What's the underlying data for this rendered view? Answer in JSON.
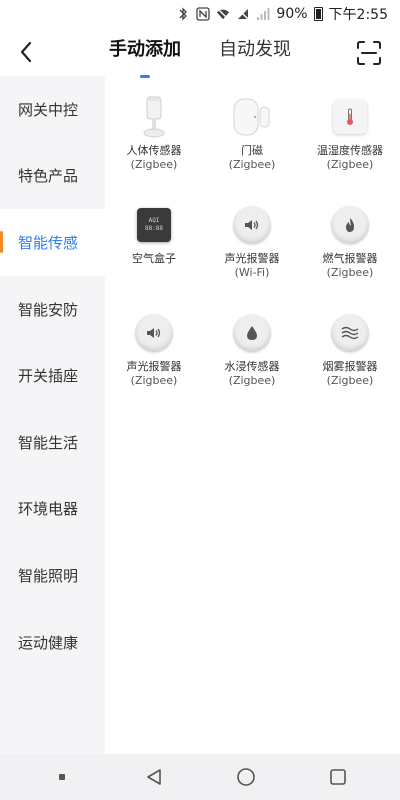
{
  "status": {
    "battery": "90%",
    "time": "下午2:55",
    "icons": [
      "bluetooth-icon",
      "nfc-icon",
      "wifi-icon",
      "mute-icon",
      "signal-icon",
      "battery-icon"
    ]
  },
  "header": {
    "tabs": [
      {
        "label": "手动添加",
        "active": true
      },
      {
        "label": "自动发现",
        "active": false
      }
    ]
  },
  "sidebar": {
    "items": [
      {
        "label": "网关中控"
      },
      {
        "label": "特色产品"
      },
      {
        "label": "智能传感",
        "active": true
      },
      {
        "label": "智能安防"
      },
      {
        "label": "开关插座"
      },
      {
        "label": "智能生活"
      },
      {
        "label": "环境电器"
      },
      {
        "label": "智能照明"
      },
      {
        "label": "运动健康"
      }
    ]
  },
  "devices": [
    {
      "name": "人体传感器",
      "protocol": "(Zigbee)",
      "icon": "motion-sensor-icon"
    },
    {
      "name": "门磁",
      "protocol": "(Zigbee)",
      "icon": "door-sensor-icon"
    },
    {
      "name": "温湿度传感器",
      "protocol": "(Zigbee)",
      "icon": "thermometer-icon"
    },
    {
      "name": "空气盒子",
      "protocol": "",
      "icon": "air-box-icon",
      "screen_text": [
        "AQI",
        "88:88"
      ]
    },
    {
      "name": "声光报警器",
      "protocol": "(Wi-Fi)",
      "icon": "speaker-icon"
    },
    {
      "name": "燃气报警器",
      "protocol": "(Zigbee)",
      "icon": "flame-icon"
    },
    {
      "name": "声光报警器",
      "protocol": "(Zigbee)",
      "icon": "speaker-icon"
    },
    {
      "name": "水浸传感器",
      "protocol": "(Zigbee)",
      "icon": "water-drop-icon"
    },
    {
      "name": "烟雾报警器",
      "protocol": "(Zigbee)",
      "icon": "smoke-waves-icon"
    }
  ],
  "colors": {
    "accent": "#2f7df6",
    "indicator": "#f58a1f",
    "sidebar_bg": "#f5f5f7"
  }
}
